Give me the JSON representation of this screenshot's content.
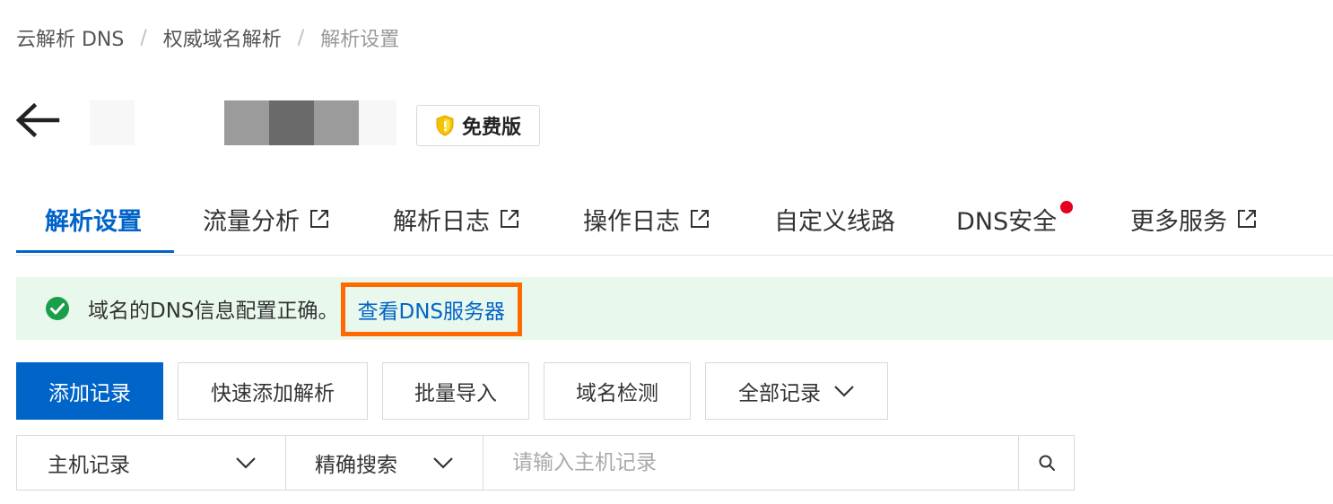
{
  "breadcrumb": {
    "items": [
      "云解析 DNS",
      "权威域名解析"
    ],
    "current": "解析设置",
    "separator": "/"
  },
  "header": {
    "back_icon": "arrow-left-icon",
    "edition_badge": "免费版",
    "edition_icon": "shield-icon"
  },
  "tabs": [
    {
      "label": "解析设置",
      "active": true,
      "external": false
    },
    {
      "label": "流量分析",
      "external": true
    },
    {
      "label": "解析日志",
      "external": true
    },
    {
      "label": "操作日志",
      "external": true
    },
    {
      "label": "自定义线路",
      "external": false
    },
    {
      "label": "DNS安全",
      "external": false,
      "notification_dot": true
    },
    {
      "label": "更多服务",
      "external": true
    }
  ],
  "alert": {
    "message": "域名的DNS信息配置正确。",
    "link": "查看DNS服务器",
    "icon": "check-circle-icon"
  },
  "toolbar": {
    "add_record": "添加记录",
    "quick_add": "快速添加解析",
    "batch_import": "批量导入",
    "domain_check": "域名检测",
    "record_filter": "全部记录"
  },
  "search": {
    "field_select": "主机记录",
    "mode_select": "精确搜索",
    "placeholder": "请输入主机记录",
    "icon": "search-icon"
  },
  "colors": {
    "primary": "#0064c8",
    "highlight_border": "#ff6a00",
    "success": "#1a9e4b",
    "alert_bg": "#e9f8ec",
    "badge_dot": "#e6001f"
  }
}
